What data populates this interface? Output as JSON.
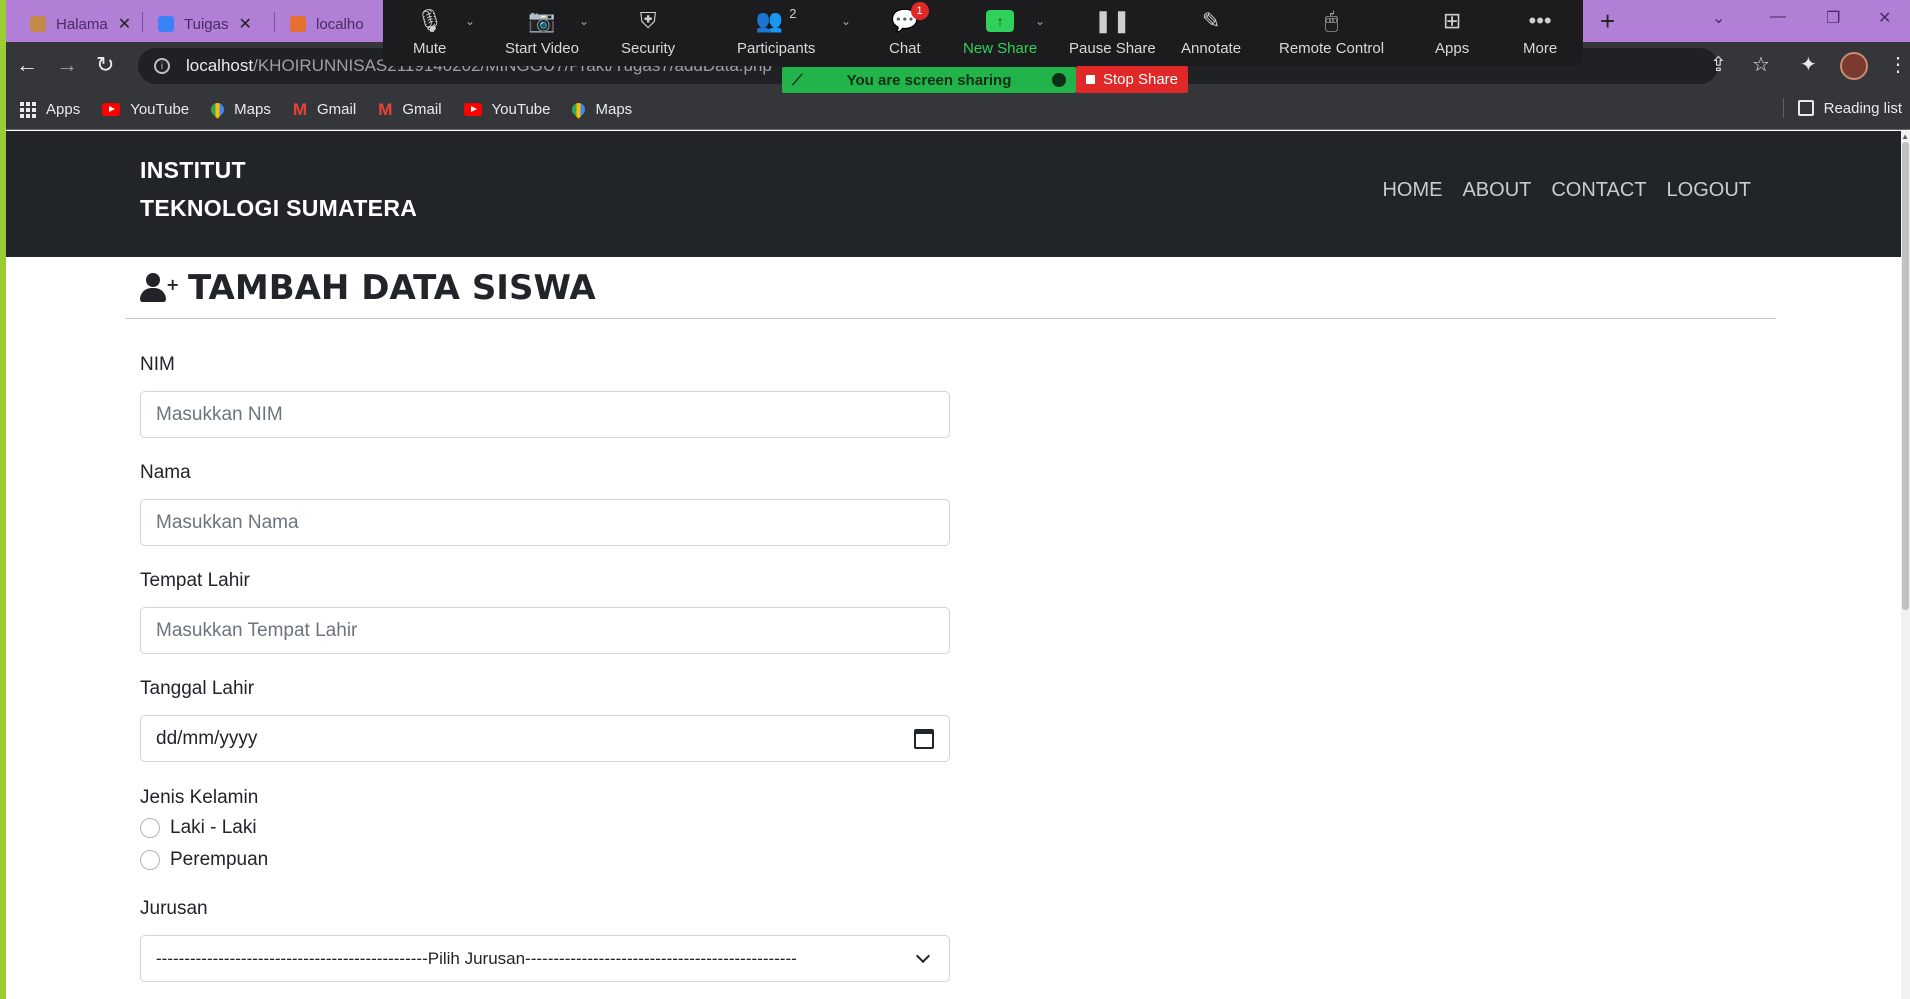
{
  "browser": {
    "tabs": [
      {
        "label": "Halama",
        "color": "#c28a4a"
      },
      {
        "label": "Tuigas",
        "color": "#3b82f6"
      },
      {
        "label": "localho",
        "color": "#e46f2e"
      }
    ],
    "url_host": "localhost",
    "url_path": "/KHOIRUNNISAS2119140202/MINGGU7/Prakt/Tugas7/addData.php",
    "bookmarks": [
      "Apps",
      "YouTube",
      "Maps",
      "Gmail",
      "Gmail",
      "YouTube",
      "Maps"
    ],
    "reading_list": "Reading list"
  },
  "zoom": {
    "items": [
      "Mute",
      "Start Video",
      "Security",
      "Participants",
      "Chat",
      "New Share",
      "Pause Share",
      "Annotate",
      "Remote Control",
      "Apps",
      "More"
    ],
    "participants_count": "2",
    "chat_badge": "1",
    "sharing_status": "You are screen sharing",
    "stop_share": "Stop Share"
  },
  "site": {
    "brand_line1": "INSTITUT",
    "brand_line2": "TEKNOLOGI SUMATERA",
    "nav": [
      "HOME",
      "ABOUT",
      "CONTACT",
      "LOGOUT"
    ]
  },
  "form": {
    "title": "TAMBAH DATA SISWA",
    "nim_label": "NIM",
    "nim_placeholder": "Masukkan NIM",
    "nama_label": "Nama",
    "nama_placeholder": "Masukkan Nama",
    "tempat_label": "Tempat Lahir",
    "tempat_placeholder": "Masukkan Tempat Lahir",
    "tanggal_label": "Tanggal Lahir",
    "tanggal_value": "dd/mm/yyyy",
    "jk_label": "Jenis Kelamin",
    "jk_options": [
      "Laki - Laki",
      "Perempuan"
    ],
    "jurusan_label": "Jurusan",
    "jurusan_selected": "------------------------------------------------Pilih Jurusan------------------------------------------------"
  },
  "colors": {
    "tab_bar": "#b27fd6",
    "browser_dark": "#35363a",
    "zoom_bar": "#1c1c1e",
    "share_green": "#23b34b",
    "stop_red": "#e02828",
    "site_header": "#212529"
  }
}
